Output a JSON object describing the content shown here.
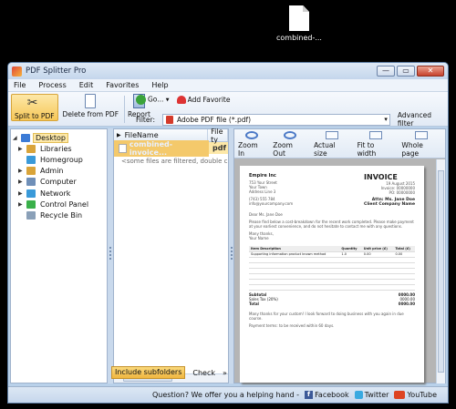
{
  "desktop": {
    "file_label": "combined-..."
  },
  "window": {
    "title": "PDF Splitter Pro",
    "btn_min": "—",
    "btn_max": "▭",
    "btn_close": "✕"
  },
  "menu": [
    "File",
    "Process",
    "Edit",
    "Favorites",
    "Help"
  ],
  "toolbar": {
    "split_label": "Split to PDF",
    "delete_label": "Delete from PDF",
    "report_label": "Report",
    "go_label": "Go... ▾",
    "add_fav_label": "Add Favorite",
    "filter_label": "Filter:",
    "filter_value": "Adobe PDF file (*.pdf)",
    "advanced_filter": "Advanced filter"
  },
  "tree": [
    {
      "label": "Desktop",
      "selected": true,
      "color": "#3b7bd6"
    },
    {
      "label": "Libraries",
      "color": "#d9a43a"
    },
    {
      "label": "Homegroup",
      "color": "#3a9ad9"
    },
    {
      "label": "Admin",
      "color": "#d9a43a"
    },
    {
      "label": "Computer",
      "color": "#6f8fb8"
    },
    {
      "label": "Network",
      "color": "#3a9ad9"
    },
    {
      "label": "Control Panel",
      "color": "#3ab04a"
    },
    {
      "label": "Recycle Bin",
      "color": "#8aa0b8"
    }
  ],
  "files": {
    "col_filename": "FileName",
    "col_filetype": "File ty",
    "rows": [
      {
        "name": "combined-invoice...",
        "type": "pdf"
      }
    ],
    "filtered_note": "<some files are filtered, double click ..."
  },
  "bottom": {
    "include_subfolders": "Include subfolders",
    "check": "Check",
    "more": "»"
  },
  "viewer": {
    "zoom_in": "Zoom In",
    "zoom_out": "Zoom Out",
    "actual_size": "Actual size",
    "fit_width": "Fit to width",
    "whole_page": "Whole page",
    "invoice": {
      "company": "Empire Inc",
      "title": "INVOICE",
      "addr1": "753 Your Street",
      "addr2": "Your Town",
      "addr3": "Address Line 3",
      "date": "19 August 2015",
      "invoice_no": "Invoice: 00000000",
      "po": "PO: 00000000",
      "phone": "(743) 555 784",
      "email": "info@yourcompany.com",
      "attn": "Attn: Ms. Jane Doe",
      "client": "Client Company Name",
      "dear": "Dear Ms. Jane Doe",
      "para": "Please find below a cost-breakdown for the recent work completed. Please make payment at your earliest convenience, and do not hesitate to contact me with any questions.",
      "sign1": "Many thanks,",
      "sign2": "Your Name",
      "th_item": "Item Description",
      "th_qty": "Quantity",
      "th_unit": "Unit price (£)",
      "th_total": "Total (£)",
      "row1_item": "Supporting information product known method",
      "row1_qty": "1.0",
      "row1_unit": "0.00",
      "row1_total": "0.00",
      "subtotal": "Subtotal",
      "subtotal_val": "0000.00",
      "sales_tax": "Sales Tax (20%)",
      "sales_tax_val": "0000.00",
      "total": "Total",
      "total_val": "0000.00",
      "footer1": "Many thanks for your custom! I look forward to doing business with you again in due course.",
      "footer2": "Payment terms: to be received within 60 days."
    }
  },
  "status": {
    "question": "Question? We offer you a helping hand -",
    "facebook": "Facebook",
    "twitter": "Twitter",
    "youtube": "YouTube"
  }
}
